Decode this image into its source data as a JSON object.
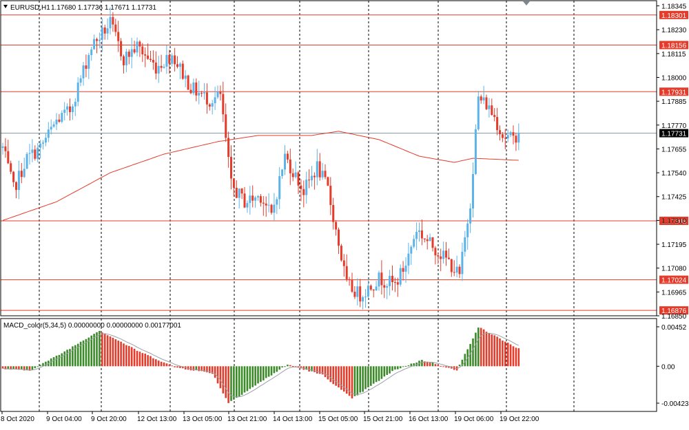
{
  "header": {
    "symbol": "EURUSD,H1",
    "ohlc": "1.17680 1.17736 1.17671 1.17731",
    "macd_label": "MACD_color(5,34,5) 0.00000000 0.00000000 0.00177001"
  },
  "colors": {
    "bull": "#5cb3ea",
    "bear": "#e53b2a",
    "level_line": "#e53b2a",
    "ma_line": "#e53b2a",
    "macd_pos": "#3a8a27",
    "macd_neg": "#e53b2a",
    "current_price_line": "#8a9aa6",
    "grid": "#000000"
  },
  "chart_data": [
    {
      "type": "candlestick",
      "y_ticks": [
        "1.18345",
        "1.18230",
        "1.18115",
        "1.18000",
        "1.17885",
        "1.17770",
        "1.17655",
        "1.17540",
        "1.17425",
        "1.17310",
        "1.17195",
        "1.17080",
        "1.16965",
        "1.16850"
      ],
      "ylim": [
        1.1685,
        1.1837
      ],
      "x_tick_labels": [
        "8 Oct 2020",
        "9 Oct 04:00",
        "9 Oct 20:00",
        "12 Oct 13:00",
        "13 Oct 05:00",
        "13 Oct 21:00",
        "14 Oct 13:00",
        "15 Oct 05:00",
        "15 Oct 21:00",
        "16 Oct 13:00",
        "19 Oct 06:00",
        "19 Oct 22:00"
      ],
      "price_levels": [
        {
          "value": 1.18301,
          "label": "1.18301"
        },
        {
          "value": 1.18156,
          "label": "1.18156"
        },
        {
          "value": 1.17931,
          "label": "1.17931"
        },
        {
          "value": 1.17308,
          "label": "1.17308"
        },
        {
          "value": 1.17024,
          "label": "1.17024"
        },
        {
          "value": 1.16876,
          "label": "1.16876"
        }
      ],
      "current_price": {
        "value": 1.17731,
        "label": "1.17731"
      },
      "anchors": [
        [
          0,
          1.1766
        ],
        [
          4,
          1.1746
        ],
        [
          9,
          1.1761
        ],
        [
          14,
          1.1766
        ],
        [
          20,
          1.1779
        ],
        [
          25,
          1.1784
        ],
        [
          33,
          1.1815
        ],
        [
          40,
          1.1826
        ],
        [
          45,
          1.1809
        ],
        [
          50,
          1.1815
        ],
        [
          57,
          1.1805
        ],
        [
          63,
          1.1811
        ],
        [
          70,
          1.1795
        ],
        [
          77,
          1.1789
        ],
        [
          81,
          1.1791
        ],
        [
          85,
          1.1748
        ],
        [
          90,
          1.174
        ],
        [
          96,
          1.1743
        ],
        [
          100,
          1.1733
        ],
        [
          105,
          1.1762
        ],
        [
          112,
          1.1745
        ],
        [
          117,
          1.1757
        ],
        [
          121,
          1.1746
        ],
        [
          128,
          1.17
        ],
        [
          133,
          1.1695
        ],
        [
          140,
          1.1703
        ],
        [
          146,
          1.17
        ],
        [
          150,
          1.171
        ],
        [
          154,
          1.1727
        ],
        [
          158,
          1.1721
        ],
        [
          162,
          1.1716
        ],
        [
          166,
          1.1711
        ],
        [
          170,
          1.1704
        ],
        [
          174,
          1.174
        ],
        [
          177,
          1.179
        ],
        [
          180,
          1.1787
        ],
        [
          183,
          1.1781
        ],
        [
          186,
          1.1772
        ],
        [
          190,
          1.177
        ],
        [
          192,
          1.1774
        ]
      ],
      "ma_points": [
        [
          0,
          1.1731
        ],
        [
          20,
          1.174
        ],
        [
          40,
          1.1754
        ],
        [
          60,
          1.1763
        ],
        [
          80,
          1.1769
        ],
        [
          95,
          1.1772
        ],
        [
          115,
          1.1772
        ],
        [
          125,
          1.1774
        ],
        [
          140,
          1.177
        ],
        [
          155,
          1.1762
        ],
        [
          168,
          1.1759
        ],
        [
          175,
          1.1761
        ],
        [
          192,
          1.176
        ]
      ]
    },
    {
      "type": "bar",
      "series_name": "MACD_color(5,34,5)",
      "y_ticks": [
        "0.00452",
        "0.00",
        "-0.00423"
      ],
      "ylim": [
        -0.00423,
        0.00452
      ],
      "anchors": [
        [
          0,
          -0.0003
        ],
        [
          10,
          -0.0005
        ],
        [
          22,
          0.0015
        ],
        [
          36,
          0.0041
        ],
        [
          50,
          0.0018
        ],
        [
          64,
          -0.0001
        ],
        [
          78,
          -0.0008
        ],
        [
          84,
          -0.0042
        ],
        [
          95,
          -0.002
        ],
        [
          106,
          0.0002
        ],
        [
          119,
          -0.001
        ],
        [
          130,
          -0.0037
        ],
        [
          146,
          -0.0004
        ],
        [
          156,
          0.0007
        ],
        [
          162,
          0.0002
        ],
        [
          169,
          -0.0005
        ],
        [
          177,
          0.0045
        ],
        [
          192,
          0.002
        ]
      ]
    }
  ]
}
